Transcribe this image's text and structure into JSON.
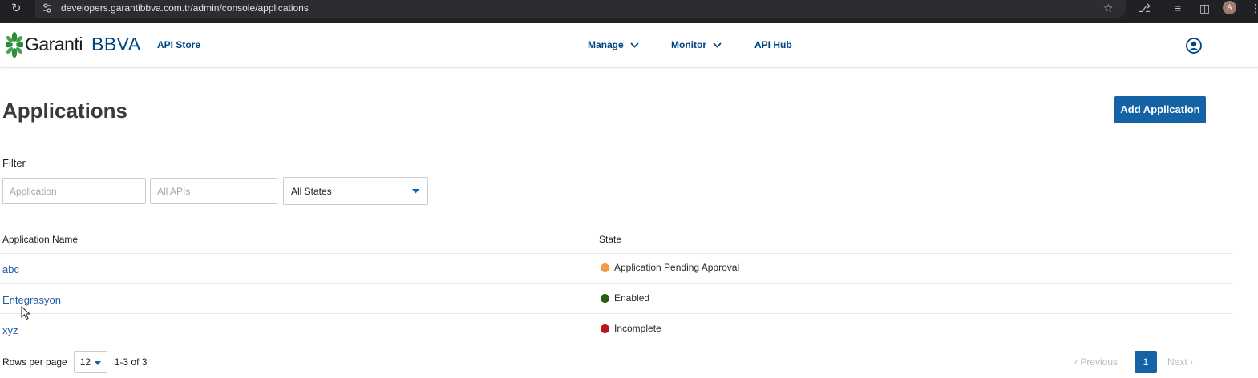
{
  "browser": {
    "url": "developers.garantibbva.com.tr/admin/console/applications",
    "profile_initial": "A"
  },
  "header": {
    "logo_garanti": "Garanti",
    "logo_bbva": "BBVA",
    "app_name": "API Store",
    "nav": [
      {
        "label": "Manage",
        "dropdown": true
      },
      {
        "label": "Monitor",
        "dropdown": true
      },
      {
        "label": "API Hub",
        "dropdown": false
      }
    ]
  },
  "page": {
    "title": "Applications",
    "add_button_label": "Add Application"
  },
  "filter": {
    "label": "Filter",
    "application_placeholder": "Application",
    "apis_placeholder": "All APIs",
    "state_selected": "All States"
  },
  "table": {
    "columns": [
      "Application Name",
      "State"
    ],
    "rows": [
      {
        "name": "abc",
        "state": "Application Pending Approval",
        "state_color": "#f2994a"
      },
      {
        "name": "Entegrasyon",
        "state": "Enabled",
        "state_color": "#2e5a14"
      },
      {
        "name": "xyz",
        "state": "Incomplete",
        "state_color": "#b8171b"
      }
    ]
  },
  "pagination": {
    "rows_per_page_label": "Rows per page",
    "rows_per_page_value": "12",
    "range_text": "1-3 of 3",
    "previous_label": "Previous",
    "current_page": "1",
    "next_label": "Next"
  },
  "colors": {
    "brand_navy": "#004481",
    "primary_button": "#1464a5",
    "link": "#1f5fa5"
  }
}
